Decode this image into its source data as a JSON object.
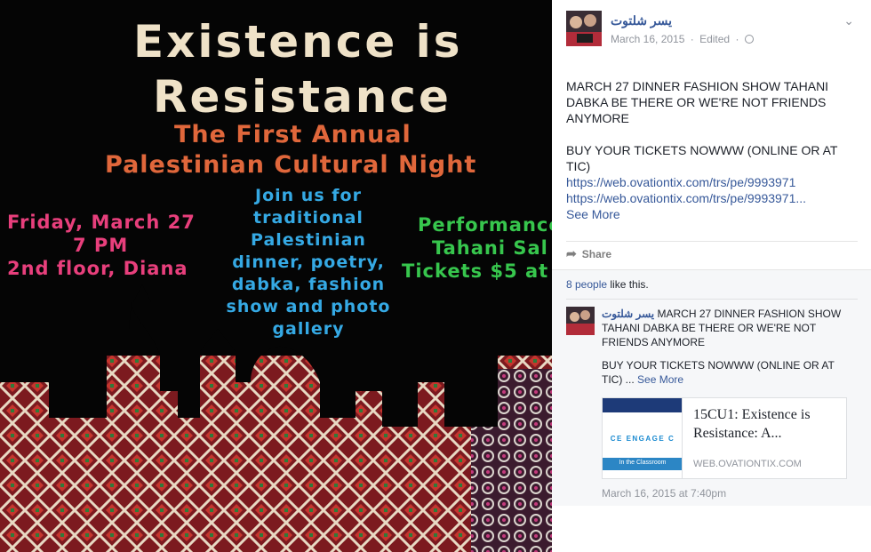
{
  "poster": {
    "title_line1": "Existence is",
    "title_line2": "Resistance",
    "subtitle_line1": "The First Annual",
    "subtitle_line2": "Palestinian Cultural Night",
    "date_line1": "Friday, March 27",
    "date_line2": "7 PM",
    "date_line3": "2nd floor, Diana",
    "center_text": "Join us for traditional Palestinian dinner, poetry, dabka, fashion show and photo gallery",
    "right_line1": "Performance",
    "right_line2": "Tahani Sal",
    "right_line3": "Tickets $5 at"
  },
  "post": {
    "author": "يسر شلتوت",
    "date": "March 16, 2015",
    "edited": "Edited",
    "separator": "·",
    "body_line1": "MARCH 27 DINNER FASHION SHOW TAHANI DABKA BE THERE OR WE'RE NOT FRIENDS ANYMORE",
    "body_line2": "BUY YOUR TICKETS NOWWW (ONLINE OR AT TIC)",
    "link1": "https://web.ovationtix.com/trs/pe/9993971",
    "link2": "https://web.ovationtix.com/trs/pe/9993971...",
    "see_more": "See More",
    "share_label": "Share"
  },
  "comments": {
    "likes_count": "8 people",
    "likes_suffix": " like this.",
    "comment": {
      "author": "يسر شلتوت",
      "text_line1": " MARCH 27 DINNER FASHION SHOW TAHANI DABKA BE THERE OR WE'RE NOT FRIENDS ANYMORE",
      "text_line2": "BUY YOUR TICKETS NOWWW (ONLINE OR AT TIC) ...",
      "see_more": "See More"
    },
    "card": {
      "image_text": "CE  ENGAGE  C",
      "image_subtext": "In the Classroom",
      "title": "15CU1: Existence is Resistance: A...",
      "domain": "WEB.OVATIONTIX.COM"
    },
    "timestamp": "March 16, 2015 at 7:40pm"
  },
  "colors": {
    "link": "#365899",
    "meta": "#90949c",
    "title_cream": "#efe2c8",
    "orange": "#e0673b",
    "pink": "#e83f7c",
    "blue": "#35a9e4",
    "green": "#37c64d"
  }
}
